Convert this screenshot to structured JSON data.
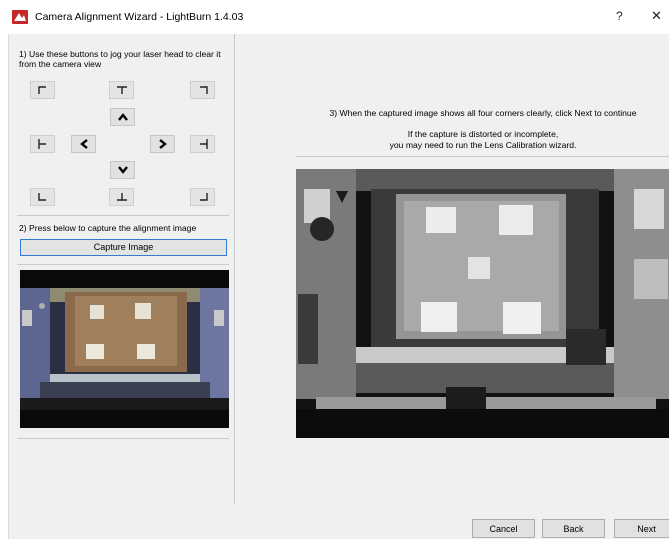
{
  "window": {
    "title": "Camera Alignment Wizard - LightBurn 1.4.03",
    "help_label": "?",
    "close_label": "✕",
    "app_icon": "lightburn-logo-icon"
  },
  "left_panel": {
    "step1_text": "1) Use these buttons to jog your laser head to clear it from the camera view",
    "jog_buttons": [
      "top-left-corner-icon",
      "top-center-icon",
      "top-right-corner-icon",
      "arrow-up-icon",
      "left-center-icon",
      "arrow-left-icon",
      "arrow-right-icon",
      "right-center-icon",
      "arrow-down-icon",
      "bottom-left-corner-icon",
      "bottom-center-icon",
      "bottom-right-corner-icon"
    ],
    "step2_text": "2) Press below to capture the alignment image",
    "capture_button": "Capture Image"
  },
  "right_panel": {
    "step3_text": "3) When the captured image shows all four corners clearly, click Next to continue",
    "distort_line1": "If the capture is distorted or incomplete,",
    "distort_line2": "you may need to run the Lens Calibration wizard."
  },
  "buttons": {
    "cancel": "Cancel",
    "back": "Back",
    "next": "Next"
  },
  "colors": {
    "window_bg": "#f0f0f0",
    "accent_border": "#2f7bd6",
    "lightburn_red": "#c62828"
  }
}
